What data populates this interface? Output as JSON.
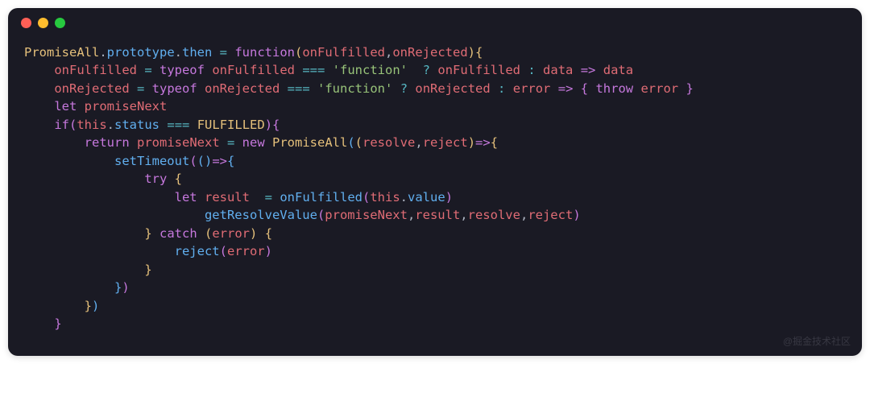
{
  "code": {
    "line1": {
      "class": "PromiseAll",
      "dot1": ".",
      "prototype": "prototype",
      "dot2": ".",
      "then": "then",
      "assign": " = ",
      "function": "function",
      "lparen": "(",
      "param1": "onFulfilled",
      "comma": ",",
      "param2": "onRejected",
      "rparen": ")",
      "lbrace": "{"
    },
    "line2": {
      "indent": "    ",
      "onFulfilled": "onFulfilled",
      "assign": " = ",
      "typeof": "typeof",
      "sp1": " ",
      "onFulfilled2": "onFulfilled",
      "sp2": " ",
      "eqq": "===",
      "sp3": " ",
      "str": "'function'",
      "sp4": "  ",
      "q": "?",
      "sp5": " ",
      "onFulfilled3": "onFulfilled",
      "sp6": " ",
      "colon": ":",
      "sp7": " ",
      "data": "data",
      "sp8": " ",
      "arrow": "=>",
      "sp9": " ",
      "data2": "data"
    },
    "line3": {
      "indent": "    ",
      "onRejected": "onRejected",
      "assign": " = ",
      "typeof": "typeof",
      "sp1": " ",
      "onRejected2": "onRejected",
      "sp2": " ",
      "eqq": "===",
      "sp3": " ",
      "str": "'function'",
      "sp4": " ",
      "q": "?",
      "sp5": " ",
      "onRejected3": "onRejected",
      "sp6": " ",
      "colon": ":",
      "sp7": " ",
      "error": "error",
      "sp8": " ",
      "arrow": "=>",
      "sp9": " ",
      "lbrace": "{",
      "sp10": " ",
      "throw": "throw",
      "sp11": " ",
      "error2": "error",
      "sp12": " ",
      "rbrace": "}"
    },
    "line4": {
      "indent": "    ",
      "let": "let",
      "sp": " ",
      "var": "promiseNext"
    },
    "line5": {
      "indent": "    ",
      "if": "if",
      "lparen": "(",
      "this": "this",
      "dot": ".",
      "status": "status",
      "sp1": " ",
      "eqq": "===",
      "sp2": " ",
      "const": "FULFILLED",
      "rparen": ")",
      "lbrace": "{"
    },
    "line6": {
      "indent": "        ",
      "return": "return",
      "sp1": " ",
      "var": "promiseNext",
      "assign": " = ",
      "new": "new",
      "sp2": " ",
      "class": "PromiseAll",
      "lparen": "(",
      "lparen2": "(",
      "resolve": "resolve",
      "comma": ",",
      "reject": "reject",
      "rparen2": ")",
      "arrow": "=>",
      "lbrace": "{"
    },
    "line7": {
      "indent": "            ",
      "func": "setTimeout",
      "lparen": "(",
      "lparen2": "(",
      "rparen2": ")",
      "arrow": "=>",
      "lbrace": "{"
    },
    "line8": {
      "indent": "                ",
      "try": "try",
      "sp": " ",
      "lbrace": "{"
    },
    "line9": {
      "indent": "                    ",
      "let": "let",
      "sp1": " ",
      "var": "result",
      "sp2": "  ",
      "assign": "=",
      "sp3": " ",
      "func": "onFulfilled",
      "lparen": "(",
      "this": "this",
      "dot": ".",
      "prop": "value",
      "rparen": ")"
    },
    "line10": {
      "indent": "                        ",
      "func": "getResolveValue",
      "lparen": "(",
      "a1": "promiseNext",
      "c1": ",",
      "a2": "result",
      "c2": ",",
      "a3": "resolve",
      "c3": ",",
      "a4": "reject",
      "rparen": ")"
    },
    "line11": {
      "indent": "                ",
      "rbrace": "}",
      "sp1": " ",
      "catch": "catch",
      "sp2": " ",
      "lparen": "(",
      "error": "error",
      "rparen": ")",
      "sp3": " ",
      "lbrace": "{"
    },
    "line12": {
      "indent": "                    ",
      "func": "reject",
      "lparen": "(",
      "arg": "error",
      "rparen": ")"
    },
    "line13": {
      "indent": "                ",
      "rbrace": "}"
    },
    "line14": {
      "indent": "            ",
      "rbrace": "}",
      "rparen": ")"
    },
    "line15": {
      "indent": "        ",
      "rbrace": "}",
      "rparen": ")"
    },
    "line16": {
      "indent": "    ",
      "rbrace": "}"
    },
    "watermark": "@掘金技术社区"
  }
}
